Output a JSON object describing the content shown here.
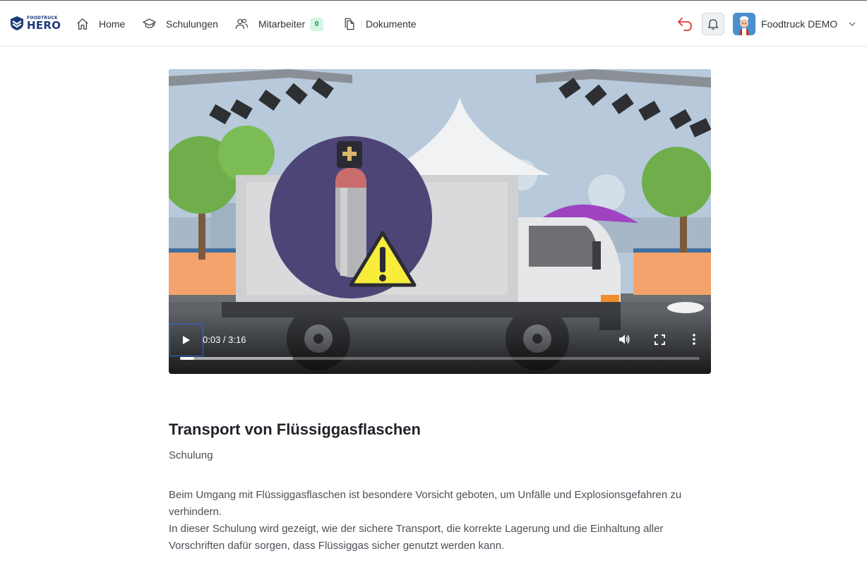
{
  "logo": {
    "top_text": "FOODTRUCK",
    "main_text": "HERO"
  },
  "nav": {
    "home": "Home",
    "schulungen": "Schulungen",
    "mitarbeiter": "Mitarbeiter",
    "mitarbeiter_count": "0",
    "dokumente": "Dokumente"
  },
  "user": {
    "name": "Foodtruck DEMO"
  },
  "colors": {
    "brand": "#1e3a7b",
    "undo": "#e0403a",
    "badge_bg": "#d5f5e3",
    "badge_text": "#1e8a4c"
  },
  "video": {
    "time": "0:03 / 3:16",
    "progress_played": 0.027,
    "progress_buffered": 0.217,
    "icons": [
      "play-icon",
      "volume-icon",
      "fullscreen-icon",
      "more-vert-icon"
    ]
  },
  "content": {
    "title": "Transport von Flüssiggasflaschen",
    "subtitle": "Schulung",
    "paragraph1": "Beim Umgang mit Flüssiggasflaschen ist besondere Vorsicht geboten, um Unfälle und Explosionsgefahren zu verhindern.",
    "paragraph2": "In dieser Schulung wird gezeigt, wie der sichere Transport, die korrekte Lagerung und die Einhaltung aller Vorschriften dafür sorgen, dass Flüssiggas sicher genutzt werden kann."
  }
}
